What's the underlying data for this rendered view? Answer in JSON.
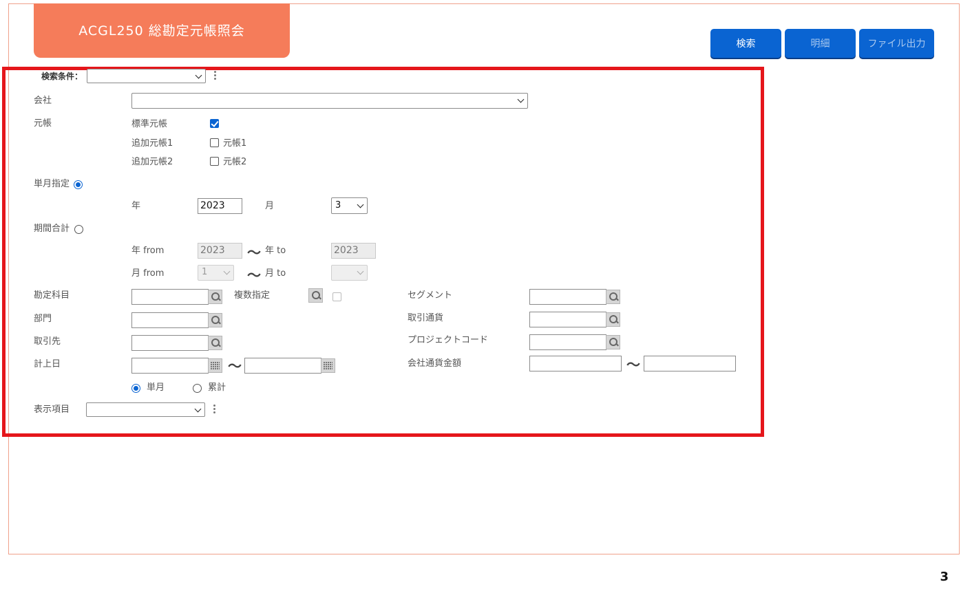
{
  "header": {
    "title": "ACGL250 総勘定元帳照会",
    "buttons": {
      "search": "検索",
      "detail": "明細",
      "file_output": "ファイル出力"
    }
  },
  "search_conditions": {
    "label": "検索条件：",
    "value": ""
  },
  "company": {
    "label": "会社",
    "value": ""
  },
  "ledger": {
    "label": "元帳",
    "standard": {
      "label": "標準元帳",
      "checked": true
    },
    "additional1": {
      "label": "追加元帳1",
      "option": "元帳1",
      "checked": false
    },
    "additional2": {
      "label": "追加元帳2",
      "option": "元帳2",
      "checked": false
    }
  },
  "single_month": {
    "label": "単月指定",
    "selected": true,
    "year_label": "年",
    "year_value": "2023",
    "month_label": "月",
    "month_value": "3"
  },
  "period_total": {
    "label": "期間合計",
    "selected": false,
    "year_from_label": "年 from",
    "year_from_value": "2023",
    "year_to_label": "年 to",
    "year_to_value": "2023",
    "month_from_label": "月 from",
    "month_from_value": "1",
    "month_to_label": "月 to",
    "month_to_value": "",
    "tilde": "〜"
  },
  "fields": {
    "account": {
      "label": "勘定科目",
      "value": ""
    },
    "multiple": {
      "label": "複数指定",
      "checked": false
    },
    "department": {
      "label": "部門",
      "value": ""
    },
    "partner": {
      "label": "取引先",
      "value": ""
    },
    "posting_date": {
      "label": "計上日",
      "from": "",
      "to": ""
    },
    "segment": {
      "label": "セグメント",
      "value": ""
    },
    "transaction_currency": {
      "label": "取引通貨",
      "value": ""
    },
    "project_code": {
      "label": "プロジェクトコード",
      "value": ""
    },
    "company_currency_amount": {
      "label": "会社通貨金額",
      "from": "",
      "to": ""
    }
  },
  "aggregation": {
    "single": "単月",
    "cumulative": "累計",
    "selected": "single"
  },
  "display_items": {
    "label": "表示項目",
    "value": ""
  },
  "page_number": "3",
  "colors": {
    "accent": "#f57c5a",
    "primary": "#0a64d2",
    "highlight_box": "#e5161b"
  }
}
